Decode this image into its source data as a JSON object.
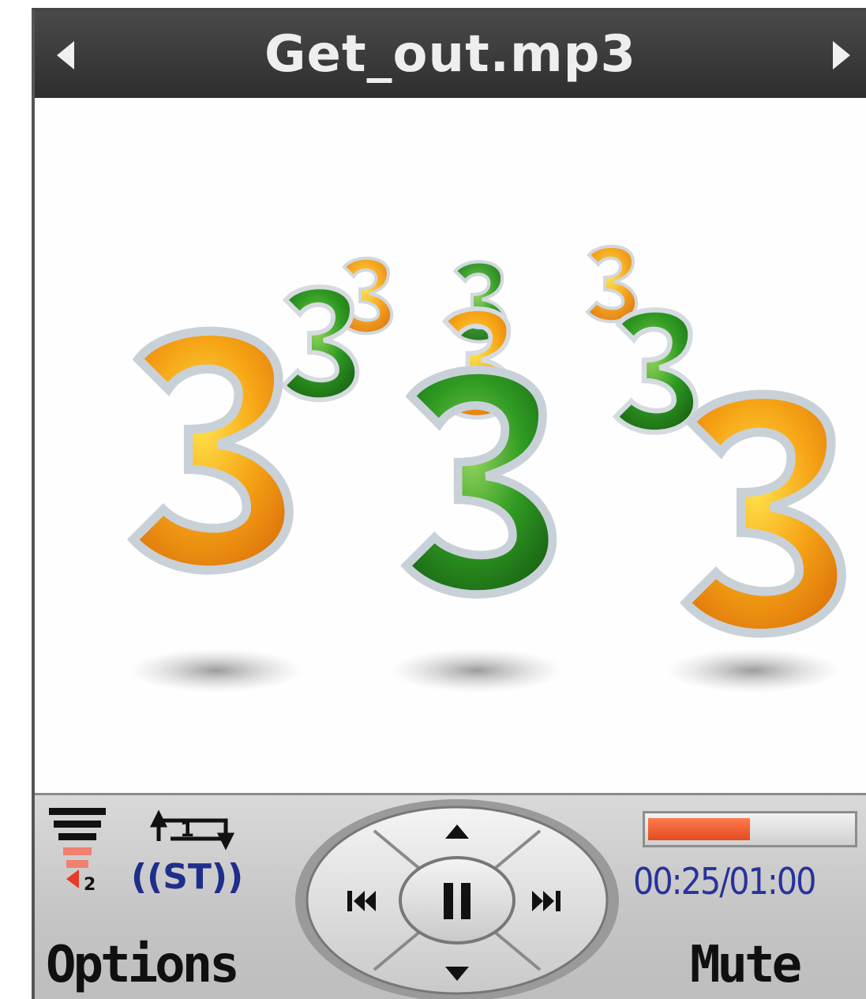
{
  "header": {
    "title": "Get_out.mp3",
    "prev_icon": "left-arrow-icon",
    "next_icon": "right-arrow-icon"
  },
  "album_art": {
    "description_icon": "album-art-threes"
  },
  "status": {
    "volume_level": 2,
    "repeat_label": "1",
    "stereo_label": "((ST))"
  },
  "controls": {
    "icons": [
      "up-icon",
      "previous-track-icon",
      "pause-icon",
      "next-track-icon",
      "down-icon"
    ]
  },
  "playback": {
    "time": "00:25/01:00",
    "progress_fraction": 0.5
  },
  "softkeys": {
    "left": "Options",
    "right": "Mute"
  },
  "colors": {
    "titlebar": "#3b3b3b",
    "progress": "#e85a2a",
    "time_text": "#27339a",
    "art_orange": "#f4a21a",
    "art_green": "#2f8f1f"
  }
}
